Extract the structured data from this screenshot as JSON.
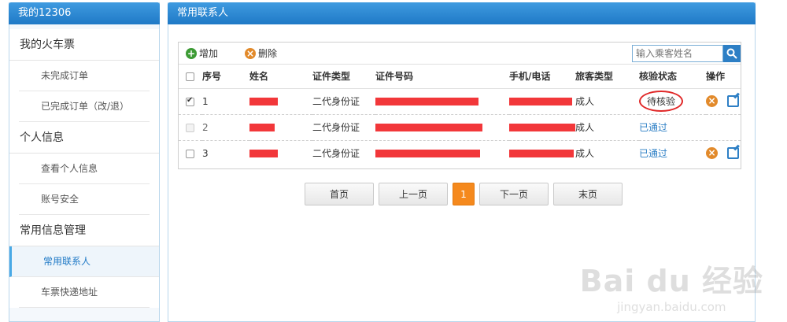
{
  "sidebar": {
    "title": "我的12306",
    "groups": [
      {
        "label": "我的火车票",
        "items": [
          "未完成订单",
          "已完成订单（改/退）"
        ]
      },
      {
        "label": "个人信息",
        "items": [
          "查看个人信息",
          "账号安全"
        ]
      },
      {
        "label": "常用信息管理",
        "items": [
          "常用联系人",
          "车票快递地址"
        ]
      }
    ]
  },
  "main": {
    "title": "常用联系人",
    "toolbar": {
      "add_label": "增加",
      "delete_label": "删除",
      "search_placeholder": "输入乘客姓名"
    },
    "columns": [
      "序号",
      "姓名",
      "证件类型",
      "证件号码",
      "手机/电话",
      "旅客类型",
      "核验状态",
      "操作"
    ],
    "rows": [
      {
        "index": "1",
        "id_type": "二代身份证",
        "passenger_type": "成人",
        "status": "待核验",
        "checked": true
      },
      {
        "index": "2",
        "id_type": "二代身份证",
        "passenger_type": "成人",
        "status": "已通过",
        "checked": false
      },
      {
        "index": "3",
        "id_type": "二代身份证",
        "passenger_type": "成人",
        "status": "已通过",
        "checked": false
      }
    ]
  },
  "pager": {
    "first": "首页",
    "prev": "上一页",
    "current": "1",
    "next": "下一页",
    "last": "末页"
  },
  "watermark": {
    "main": "Bai du 经验",
    "sub": "jingyan.baidu.com"
  },
  "colors": {
    "header_blue": "#1f79c6",
    "accent_orange": "#f5891d",
    "redaction": "#f2373a",
    "link_blue": "#2d7fc5"
  }
}
